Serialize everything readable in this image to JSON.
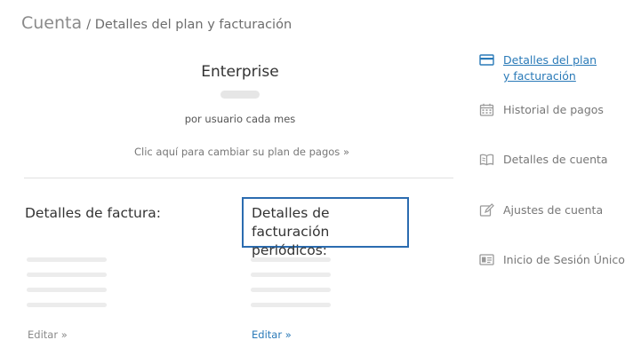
{
  "breadcrumb": {
    "root": "Cuenta",
    "current": "/ Detalles del plan y facturación"
  },
  "plan": {
    "name": "Enterprise",
    "period": "por usuario cada mes",
    "change_link": "Clic aquí para cambiar su plan de pagos »"
  },
  "invoice": {
    "title": "Detalles de factura:",
    "edit": "Editar »"
  },
  "recurring": {
    "title_line1": "Detalles de facturación",
    "title_line2": "periódicos:",
    "edit": "Editar »"
  },
  "sidebar": {
    "items": [
      {
        "line1": "Detalles del plan",
        "line2": "y facturación",
        "icon": "credit-card-icon",
        "active": true
      },
      {
        "label": "Historial de pagos",
        "icon": "calendar-icon"
      },
      {
        "label": "Detalles de cuenta",
        "icon": "book-icon"
      },
      {
        "label": "Ajustes de cuenta",
        "icon": "edit-icon"
      },
      {
        "label": "Inicio de Sesión Único",
        "icon": "id-card-icon"
      }
    ]
  },
  "colors": {
    "link": "#2a7ab8",
    "highlight_border": "#2b6cb0",
    "icon": "#999999"
  }
}
